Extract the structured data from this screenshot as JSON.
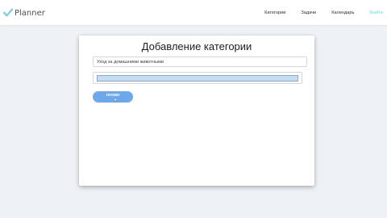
{
  "app": {
    "brand_name": "Planner",
    "logo_icon": "checkmark-logo-icon"
  },
  "nav": {
    "items": [
      {
        "label": "Категории"
      },
      {
        "label": "Задачи"
      },
      {
        "label": "Календарь"
      },
      {
        "label": "Выйти"
      }
    ]
  },
  "form": {
    "title": "Добавление категории",
    "name_field": {
      "value": "Уход за домашними животными"
    },
    "color_field": {
      "value": "#c6dcf2"
    },
    "submit_label": "готово"
  },
  "colors": {
    "accent": "#6ea8e8",
    "logo": "#7fcfe0",
    "logout_link": "#7fcfe0"
  }
}
